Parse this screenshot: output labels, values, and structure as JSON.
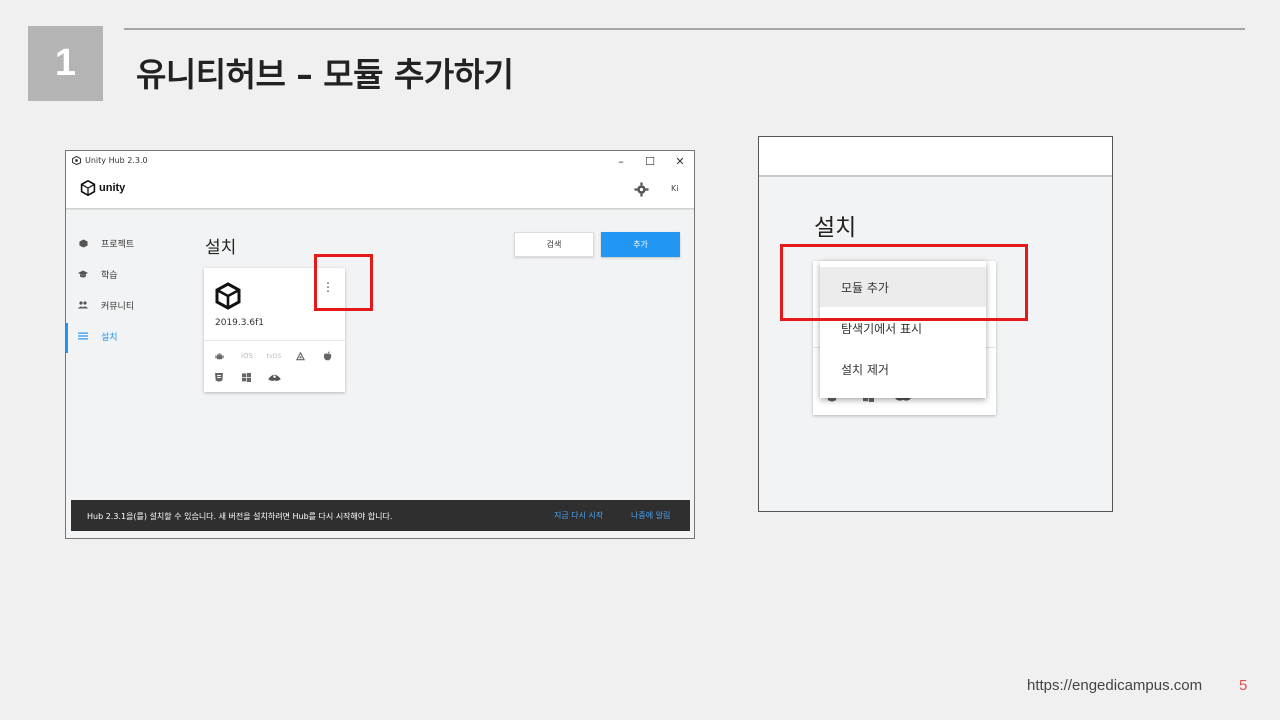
{
  "slide": {
    "number": "1",
    "title": "유니티허브 – 모듈 추가하기",
    "footer_url": "https://engedicampus.com",
    "page": "5"
  },
  "window": {
    "title": "Unity Hub 2.3.0",
    "controls": {
      "minimize": "–",
      "maximize": "☐",
      "close": "✕"
    },
    "logo_text": "unity",
    "user_initials": "Ki"
  },
  "sidebar": {
    "items": [
      {
        "label": "프로젝트",
        "icon": "cube-icon",
        "active": false
      },
      {
        "label": "학습",
        "icon": "graduation-cap-icon",
        "active": false
      },
      {
        "label": "커뮤니티",
        "icon": "people-icon",
        "active": false
      },
      {
        "label": "설치",
        "icon": "list-icon",
        "active": true
      }
    ]
  },
  "main": {
    "heading": "설치",
    "search_label": "검색",
    "add_label": "추가",
    "install_card": {
      "version": "2019.3.6f1",
      "platforms_row1": [
        "android-icon",
        "iOS",
        "tvOS",
        "linux-icon",
        "apple-icon"
      ],
      "platforms_row2": [
        "html5-icon",
        "windows-icon",
        "lumin-icon"
      ]
    }
  },
  "toast": {
    "message": "Hub 2.3.1을(를) 설치할 수 있습니다. 새 버전을 설치하려면 Hub를 다시 시작해야 합니다.",
    "restart_now": "지금 다시 시작",
    "remind_later": "나중에 알림"
  },
  "zoom": {
    "heading": "설치",
    "menu": [
      {
        "label": "모듈 추가",
        "highlighted": true
      },
      {
        "label": "탐색기에서 표시",
        "highlighted": false
      },
      {
        "label": "설치 제거",
        "highlighted": false
      }
    ]
  },
  "colors": {
    "accent": "#2196f3",
    "highlight_box": "#e41919",
    "page_number": "#e05050"
  }
}
